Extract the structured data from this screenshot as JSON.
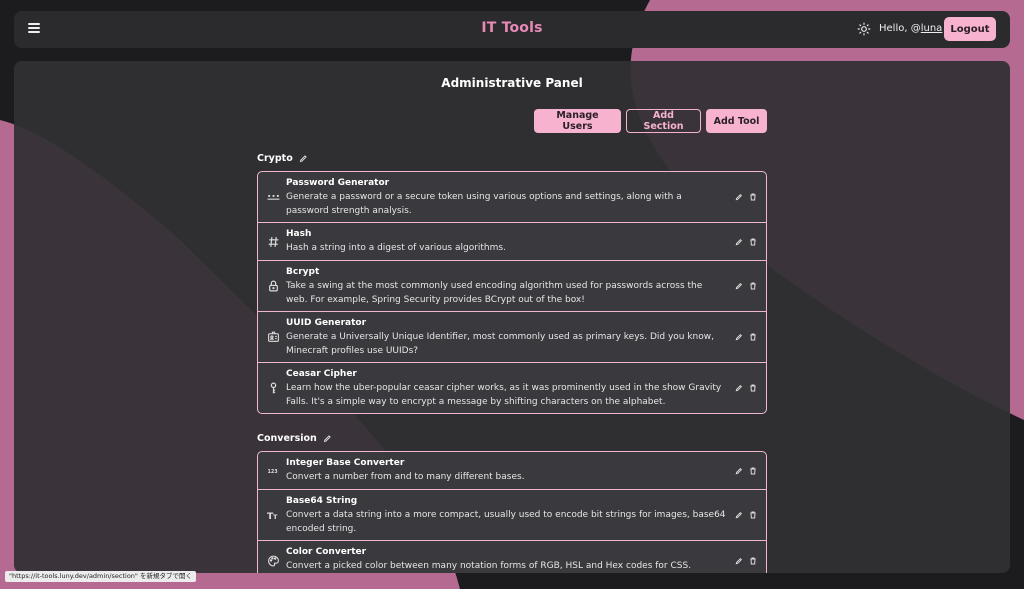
{
  "header": {
    "brand": "IT Tools",
    "greeting_prefix": "Hello, @",
    "username": "luna",
    "logout_label": "Logout",
    "menu_icon": "hamburger-icon",
    "theme_icon": "sun-icon"
  },
  "panel": {
    "title": "Administrative Panel",
    "buttons": {
      "manage_users": "Manage Users",
      "add_section": "Add Section",
      "add_tool": "Add Tool"
    }
  },
  "sections": [
    {
      "name": "Crypto",
      "tools": [
        {
          "icon": "password-dots-icon",
          "name": "Password Generator",
          "desc": "Generate a password or a secure token using various options and settings, along with a password strength analysis."
        },
        {
          "icon": "hash-icon",
          "name": "Hash",
          "desc": "Hash a string into a digest of various algorithms."
        },
        {
          "icon": "lock-icon",
          "name": "Bcrypt",
          "desc": "Take a swing at the most commonly used encoding algorithm used for passwords across the web. For example, Spring Security provides BCrypt out of the box!"
        },
        {
          "icon": "id-card-icon",
          "name": "UUID Generator",
          "desc": "Generate a Universally Unique Identifier, most commonly used as primary keys. Did you know, Minecraft profiles use UUIDs?"
        },
        {
          "icon": "key-icon",
          "name": "Ceasar Cipher",
          "desc": "Learn how the uber-popular ceasar cipher works, as it was prominently used in the show Gravity Falls. It's a simple way to encrypt a message by shifting characters on the alphabet."
        }
      ]
    },
    {
      "name": "Conversion",
      "tools": [
        {
          "icon": "numbers-123-icon",
          "name": "Integer Base Converter",
          "desc": "Convert a number from and to many different bases."
        },
        {
          "icon": "text-size-icon",
          "name": "Base64 String",
          "desc": "Convert a data string into a more compact, usually used to encode bit strings for images, base64 encoded string."
        },
        {
          "icon": "palette-icon",
          "name": "Color Converter",
          "desc": "Convert a picked color between many notation forms of RGB, HSL and Hex codes for CSS."
        }
      ]
    }
  ],
  "status_bar": {
    "text": "\"https://it-tools.luny.dev/admin/section\" を新規タブで開く"
  },
  "colors": {
    "accent": "#f7b2d0",
    "brand": "#e889b6",
    "background_pink": "#b56a92",
    "panel": "#303034"
  }
}
